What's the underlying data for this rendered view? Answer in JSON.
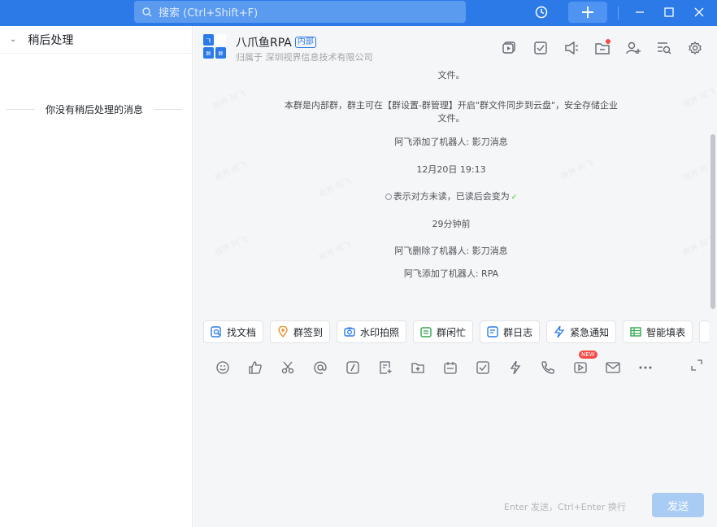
{
  "titlebar": {
    "search_placeholder": "搜索 (Ctrl+Shift+F)",
    "accent": "#2b7ae8"
  },
  "left_panel": {
    "title": "稍后处理",
    "empty_text": "你没有稍后处理的消息"
  },
  "chat_header": {
    "group_name": "八爪鱼RPA",
    "tag": "内部",
    "org": "归属于 深圳视界信息技术有限公司",
    "avatar_chars": [
      "飞",
      "",
      "群",
      "群"
    ],
    "icons": [
      "meeting-icon",
      "task-icon",
      "announcement-icon",
      "file-icon",
      "add-member-icon",
      "search-history-icon",
      "settings-icon"
    ]
  },
  "messages": [
    {
      "text": "本群是内部群，群主可在【群设置-群管理】开启\"群文件同步到云盘\"，安全存储企业文件。",
      "kind": "system"
    },
    {
      "text": "本群是内部群，群主可在【群设置-群管理】开启\"群文件同步到云盘\"，安全存储企业文件。",
      "kind": "system"
    },
    {
      "text": "阿飞添加了机器人: 影刀消息",
      "kind": "system"
    },
    {
      "text": "12月20日 19:13",
      "kind": "time"
    },
    {
      "text": "表示对方未读，已读后会变为",
      "kind": "read-hint"
    },
    {
      "text": "29分钟前",
      "kind": "time"
    },
    {
      "text": "阿飞删除了机器人: 影刀消息",
      "kind": "system"
    },
    {
      "text": "阿飞添加了机器人: RPA",
      "kind": "system"
    }
  ],
  "quick_apps": [
    {
      "label": "找文档",
      "icon": "find-doc-icon",
      "color": "#2b7ae8"
    },
    {
      "label": "群签到",
      "icon": "checkin-icon",
      "color": "#f08c2b"
    },
    {
      "label": "水印拍照",
      "icon": "camera-icon",
      "color": "#2b7ae8"
    },
    {
      "label": "群闲忙",
      "icon": "calendar-icon",
      "color": "#34a853"
    },
    {
      "label": "群日志",
      "icon": "log-icon",
      "color": "#2b7ae8"
    },
    {
      "label": "紧急通知",
      "icon": "urgent-icon",
      "color": "#2b7ae8"
    },
    {
      "label": "智能填表",
      "icon": "sheet-icon",
      "color": "#34a853"
    }
  ],
  "composer": {
    "tools": [
      "emoji-icon",
      "like-icon",
      "scissors-icon",
      "mention-icon",
      "slash-icon",
      "note-icon",
      "upload-folder-icon",
      "calendar-icon",
      "task-check-icon",
      "lightning-icon",
      "phone-icon",
      "video-icon",
      "mail-icon",
      "more-icon"
    ],
    "new_badge": "NEW",
    "hint": "Enter 发送，Ctrl+Enter 换行",
    "send_label": "发送"
  }
}
